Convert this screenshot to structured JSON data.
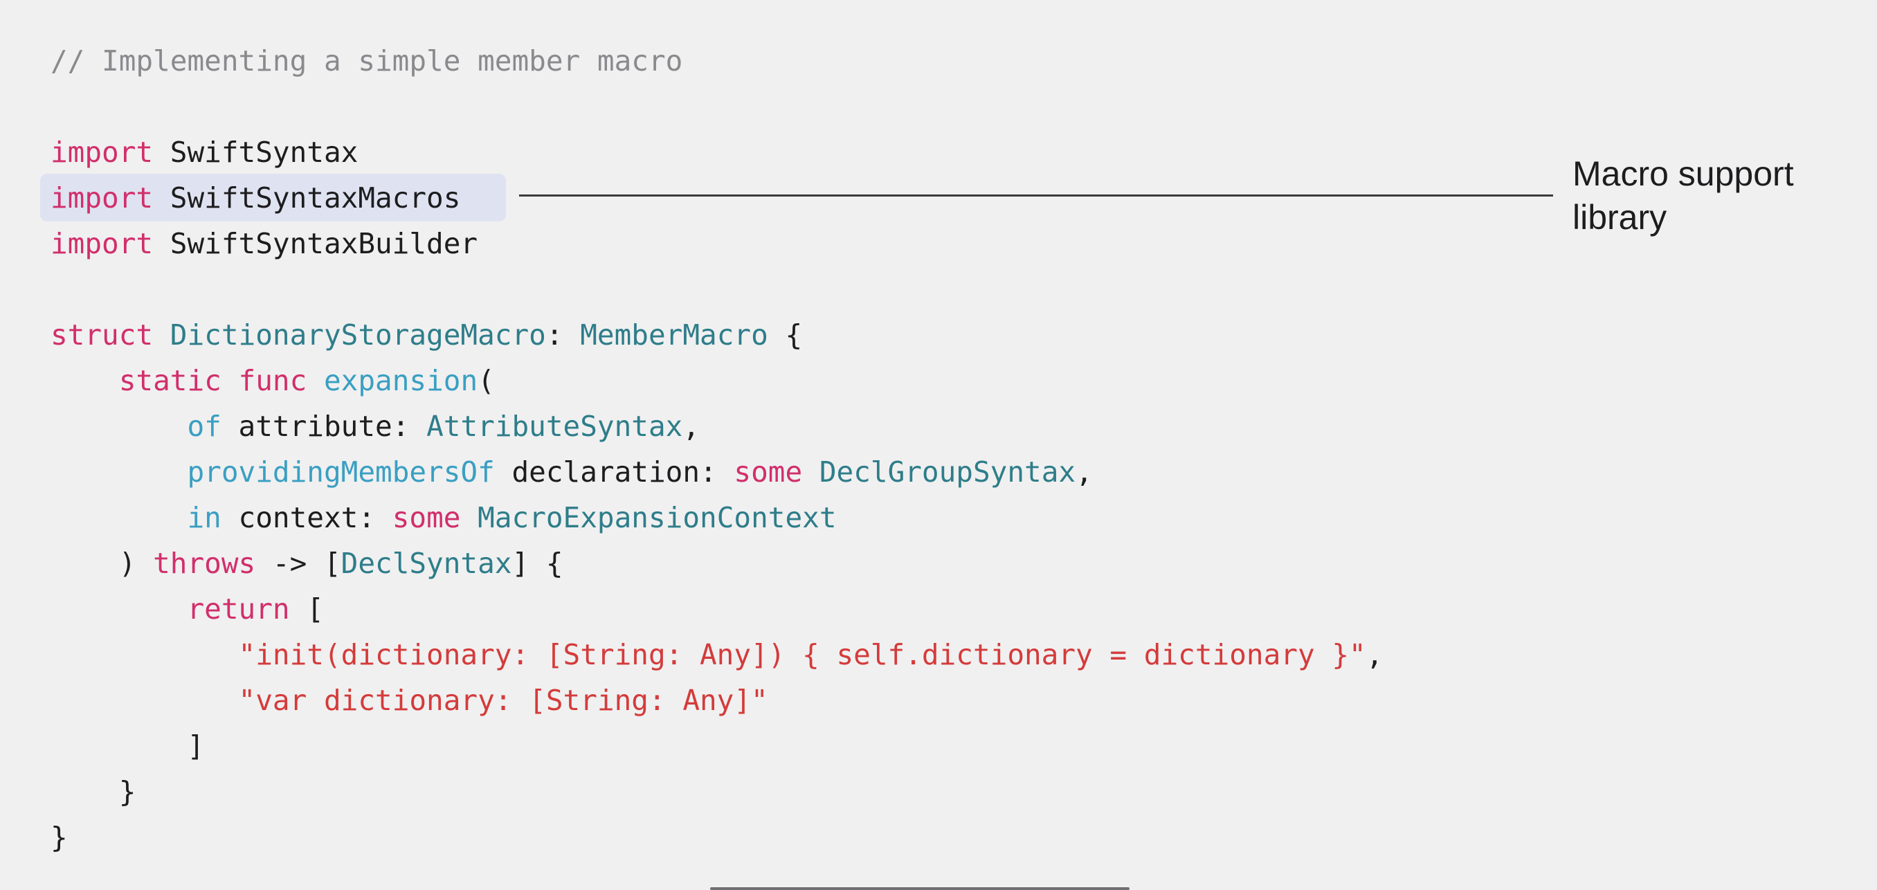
{
  "annotation": {
    "label_lines": [
      "Macro support",
      "library"
    ]
  },
  "code": {
    "lines": [
      {
        "tokens": [
          {
            "t": "// Implementing a simple member macro",
            "k": "comment"
          }
        ]
      },
      {
        "tokens": []
      },
      {
        "tokens": [
          {
            "t": "import",
            "k": "keyword"
          },
          {
            "t": " SwiftSyntax",
            "k": "plain"
          }
        ]
      },
      {
        "tokens": [
          {
            "t": "import",
            "k": "keyword"
          },
          {
            "t": " SwiftSyntaxMacros",
            "k": "plain"
          }
        ],
        "highlighted": true
      },
      {
        "tokens": [
          {
            "t": "import",
            "k": "keyword"
          },
          {
            "t": " SwiftSyntaxBuilder",
            "k": "plain"
          }
        ]
      },
      {
        "tokens": []
      },
      {
        "tokens": [
          {
            "t": "struct",
            "k": "keyword"
          },
          {
            "t": " ",
            "k": "plain"
          },
          {
            "t": "DictionaryStorageMacro",
            "k": "type"
          },
          {
            "t": ": ",
            "k": "plain"
          },
          {
            "t": "MemberMacro",
            "k": "type"
          },
          {
            "t": " {",
            "k": "plain"
          }
        ]
      },
      {
        "tokens": [
          {
            "t": "    ",
            "k": "plain"
          },
          {
            "t": "static",
            "k": "keyword"
          },
          {
            "t": " ",
            "k": "plain"
          },
          {
            "t": "func",
            "k": "keyword"
          },
          {
            "t": " ",
            "k": "plain"
          },
          {
            "t": "expansion",
            "k": "param"
          },
          {
            "t": "(",
            "k": "plain"
          }
        ]
      },
      {
        "tokens": [
          {
            "t": "        ",
            "k": "plain"
          },
          {
            "t": "of",
            "k": "param"
          },
          {
            "t": " attribute: ",
            "k": "plain"
          },
          {
            "t": "AttributeSyntax",
            "k": "type"
          },
          {
            "t": ",",
            "k": "plain"
          }
        ]
      },
      {
        "tokens": [
          {
            "t": "        ",
            "k": "plain"
          },
          {
            "t": "providingMembersOf",
            "k": "param"
          },
          {
            "t": " declaration: ",
            "k": "plain"
          },
          {
            "t": "some",
            "k": "keyword"
          },
          {
            "t": " ",
            "k": "plain"
          },
          {
            "t": "DeclGroupSyntax",
            "k": "type"
          },
          {
            "t": ",",
            "k": "plain"
          }
        ]
      },
      {
        "tokens": [
          {
            "t": "        ",
            "k": "plain"
          },
          {
            "t": "in",
            "k": "param"
          },
          {
            "t": " context: ",
            "k": "plain"
          },
          {
            "t": "some",
            "k": "keyword"
          },
          {
            "t": " ",
            "k": "plain"
          },
          {
            "t": "MacroExpansionContext",
            "k": "type"
          }
        ]
      },
      {
        "tokens": [
          {
            "t": "    ) ",
            "k": "plain"
          },
          {
            "t": "throws",
            "k": "keyword"
          },
          {
            "t": " -> [",
            "k": "plain"
          },
          {
            "t": "DeclSyntax",
            "k": "type"
          },
          {
            "t": "] {",
            "k": "plain"
          }
        ]
      },
      {
        "tokens": [
          {
            "t": "        ",
            "k": "plain"
          },
          {
            "t": "return",
            "k": "keyword"
          },
          {
            "t": " [",
            "k": "plain"
          }
        ]
      },
      {
        "tokens": [
          {
            "t": "           ",
            "k": "plain"
          },
          {
            "t": "\"init(dictionary: [String: Any]) { self.dictionary = dictionary }\"",
            "k": "string"
          },
          {
            "t": ",",
            "k": "plain"
          }
        ]
      },
      {
        "tokens": [
          {
            "t": "           ",
            "k": "plain"
          },
          {
            "t": "\"var dictionary: [String: Any]\"",
            "k": "string"
          }
        ]
      },
      {
        "tokens": [
          {
            "t": "        ]",
            "k": "plain"
          }
        ]
      },
      {
        "tokens": [
          {
            "t": "    }",
            "k": "plain"
          }
        ]
      },
      {
        "tokens": [
          {
            "t": "}",
            "k": "plain"
          }
        ]
      }
    ]
  }
}
